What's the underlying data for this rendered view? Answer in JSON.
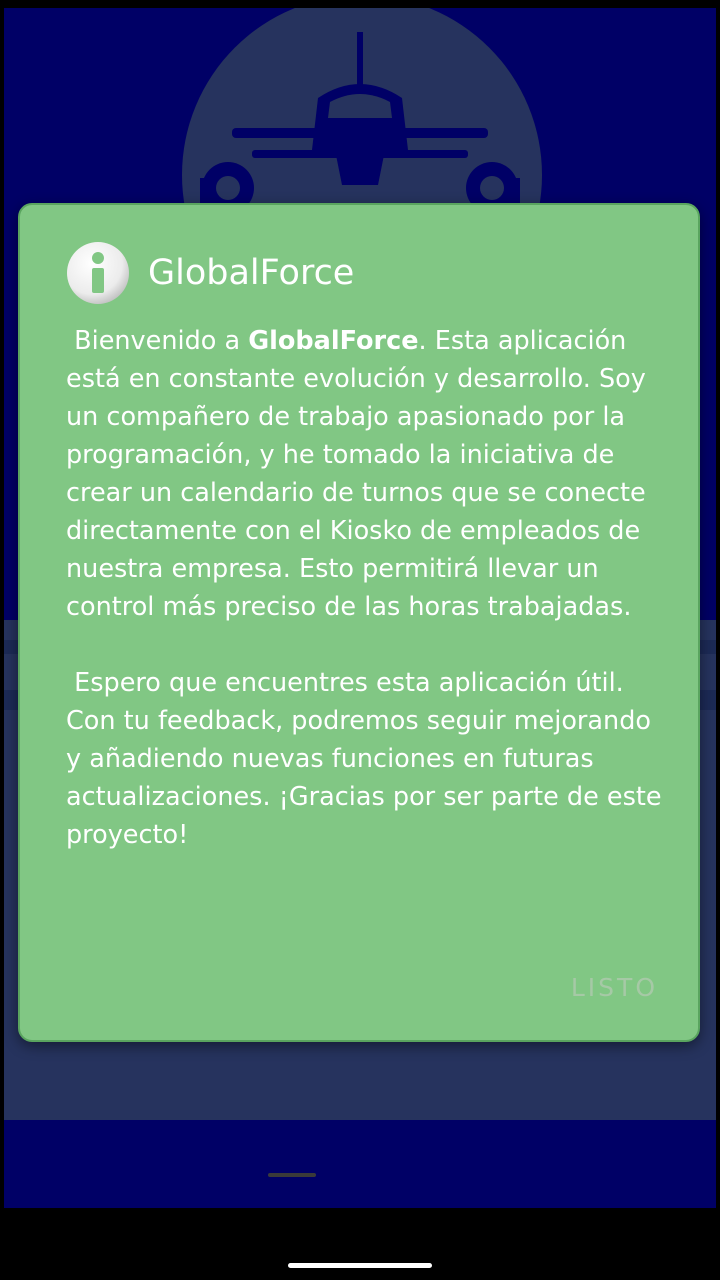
{
  "app": {
    "name": "GlobalForce"
  },
  "dialog": {
    "icon": "info-icon",
    "title": "GlobalForce",
    "paragraph1": {
      "lead": " Bienvenido a ",
      "brand": "GlobalForce",
      "rest": ". Esta aplicación está en constante evolución y desarrollo. Soy un compañero de trabajo apasionado por la programación, y he tomado la iniciativa de crear un calendario de turnos que se conecte directamente con el Kiosko de empleados de nuestra empresa. Esto permitirá llevar un control más preciso de las horas trabajadas."
    },
    "paragraph2": " Espero que encuentres esta aplicación útil. Con tu feedback, podremos seguir mejorando y añadiendo nuevas funciones en futuras actualizaciones. ¡Gracias por ser parte de este proyecto!",
    "done_label": "LISTO"
  },
  "colors": {
    "background": "#000066",
    "dialog": "#81c784",
    "dialog_text": "#ffffff",
    "button_disabled": "#a6c9a6"
  }
}
